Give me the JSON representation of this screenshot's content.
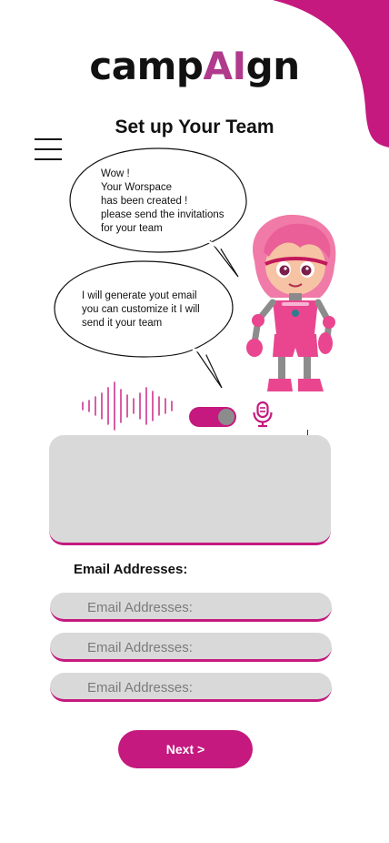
{
  "brand": {
    "logo_prefix": "camp",
    "logo_ai": "AI",
    "logo_suffix": "gn",
    "accent_color": "#c5197f"
  },
  "header": {
    "title": "Set up Your Team",
    "menu_icon": "hamburger-icon"
  },
  "assistant": {
    "bubble_1": "Wow !\nYour Worspace\nhas been created !\nplease send the invitations\nfor your team",
    "bubble_2": "I will generate yout email\nyou can customize it I will\nsend it your team",
    "avatar": "robot-girl-mascot"
  },
  "voice_controls": {
    "waveform_icon": "audio-waveform-icon",
    "toggle_state": "on",
    "mic_icon": "microphone-icon"
  },
  "email": {
    "label": "Email Addresses:",
    "fields": [
      {
        "placeholder": "Email Addresses:"
      },
      {
        "placeholder": "Email Addresses:"
      },
      {
        "placeholder": "Email Addresses:"
      }
    ]
  },
  "actions": {
    "next_label": "Next >"
  }
}
